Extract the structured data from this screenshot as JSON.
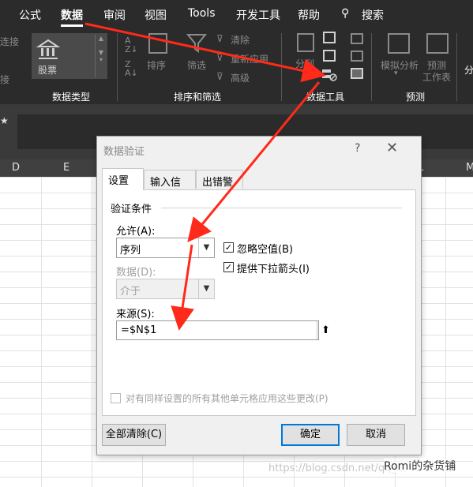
{
  "ribbon": {
    "tabs": [
      "公式",
      "数据",
      "审阅",
      "视图",
      "Tools",
      "开发工具",
      "帮助",
      "搜索"
    ],
    "active_tab": "数据",
    "groups": {
      "data_types": "数据类型",
      "sort_filter": "排序和筛选",
      "data_tools": "数据工具",
      "forecast": "预测"
    },
    "buttons": {
      "stock": "股票",
      "sort": "排序",
      "filter": "筛选",
      "clear": "清除",
      "reapply": "重新应用",
      "advanced": "高级",
      "text_to_columns": "分列",
      "what_if": "模拟分析",
      "forecast_sheet_line1": "预测",
      "forecast_sheet_line2": "工作表",
      "left_clip_1": "连接",
      "left_clip_2": "接",
      "right_clip": "分"
    }
  },
  "formula_bar": {
    "star": "★"
  },
  "columns": [
    "D",
    "E",
    "L",
    "M"
  ],
  "dialog": {
    "title": "数据验证",
    "help": "?",
    "close": "✕",
    "tabs": [
      "设置",
      "输入信息",
      "出错警告"
    ],
    "section": "验证条件",
    "allow_label": "允许(A):",
    "allow_value": "序列",
    "data_label": "数据(D):",
    "data_value": "介于",
    "ignore_blank": "忽略空值(B)",
    "dropdown": "提供下拉箭头(I)",
    "source_label": "来源(S):",
    "source_value": "=$N$1",
    "apply_all": "对有同样设置的所有其他单元格应用这些更改(P)",
    "clear_all": "全部清除(C)",
    "ok": "确定",
    "cancel": "取消"
  },
  "watermark": "https://blog.csdn.net/qq_...",
  "brand": "Romi的杂货铺",
  "colors": {
    "ribbon_bg": "#2b2b2b",
    "arrow": "#ff2a1a",
    "dialog_bg": "#f0f0f0",
    "focus": "#0078d7"
  }
}
